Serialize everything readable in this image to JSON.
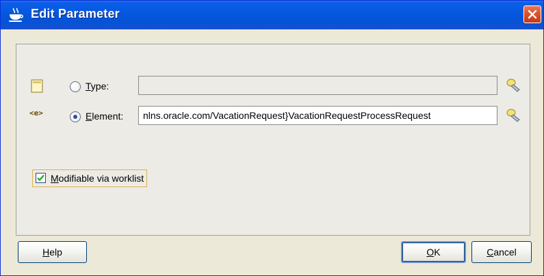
{
  "window": {
    "title": "Edit Parameter",
    "title_icon": "coffee-cup-icon",
    "close_icon": "close-icon"
  },
  "type_row": {
    "icon": "class-type-icon",
    "label_mnemonic": "T",
    "label_rest": "ype:",
    "value": "",
    "selected": false,
    "browse_icon": "flashlight-browse-icon"
  },
  "element_row": {
    "icon": "xml-element-icon",
    "icon_text": "<e>",
    "label_mnemonic": "E",
    "label_rest": "lement:",
    "value": "nlns.oracle.com/VacationRequest}VacationRequestProcessRequest",
    "selected": true,
    "browse_icon": "flashlight-browse-icon"
  },
  "modifiable": {
    "label_mnemonic": "M",
    "label_rest": "odifiable via worklist",
    "checked": true
  },
  "buttons": {
    "help_mnemonic": "H",
    "help_rest": "elp",
    "ok_mnemonic": "O",
    "ok_rest": "K",
    "cancel_mnemonic": "C",
    "cancel_rest": "ancel"
  },
  "colors": {
    "titlebar": "#0553d6",
    "dialog_bg": "#ece9d8",
    "close_button": "#d9532f",
    "check_mark": "#21a121"
  }
}
